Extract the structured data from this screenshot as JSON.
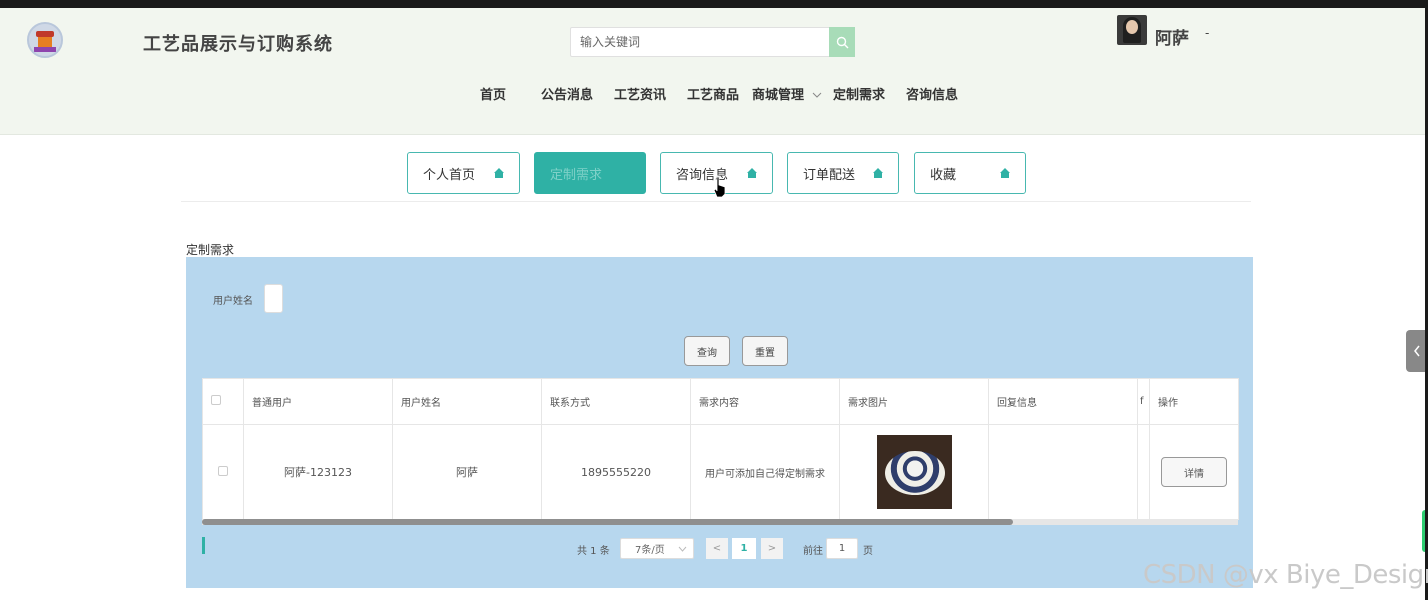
{
  "header": {
    "site_title": "工艺品展示与订购系统",
    "search_placeholder": "输入关键词",
    "username": "阿萨",
    "user_caret": "-"
  },
  "nav": {
    "items": [
      {
        "label": "首页"
      },
      {
        "label": "公告消息"
      },
      {
        "label": "工艺资讯"
      },
      {
        "label": "工艺商品"
      },
      {
        "label": "商城管理"
      },
      {
        "label": "定制需求"
      },
      {
        "label": "咨询信息"
      }
    ]
  },
  "tabs": [
    {
      "label": "个人首页"
    },
    {
      "label": "定制需求",
      "active": true
    },
    {
      "label": "咨询信息"
    },
    {
      "label": "订单配送"
    },
    {
      "label": "收藏"
    }
  ],
  "section": {
    "title": "定制需求"
  },
  "filter": {
    "username_label": "用户姓名",
    "query_button": "查询",
    "reset_button": "重置"
  },
  "table": {
    "headers": [
      "普通用户",
      "用户姓名",
      "联系方式",
      "需求内容",
      "需求图片",
      "回复信息",
      "f",
      "操作"
    ],
    "rows": [
      {
        "user": "阿萨-123123",
        "name": "阿萨",
        "phone": "1895555220",
        "content": "用户可添加自己得定制需求",
        "reply": "",
        "action": "详情"
      }
    ]
  },
  "pagination": {
    "total": "共 1 条",
    "page_size": "7条/页",
    "current_page": "1",
    "prev": "<",
    "next": ">",
    "goto_label": "前往",
    "goto_value": "1",
    "page_suffix": "页"
  },
  "watermark": "CSDN @vx Biye_Design",
  "colors": {
    "accent": "#2fb1a5",
    "panel": "#b7d7ee",
    "header_bg": "#f2f6ef"
  }
}
